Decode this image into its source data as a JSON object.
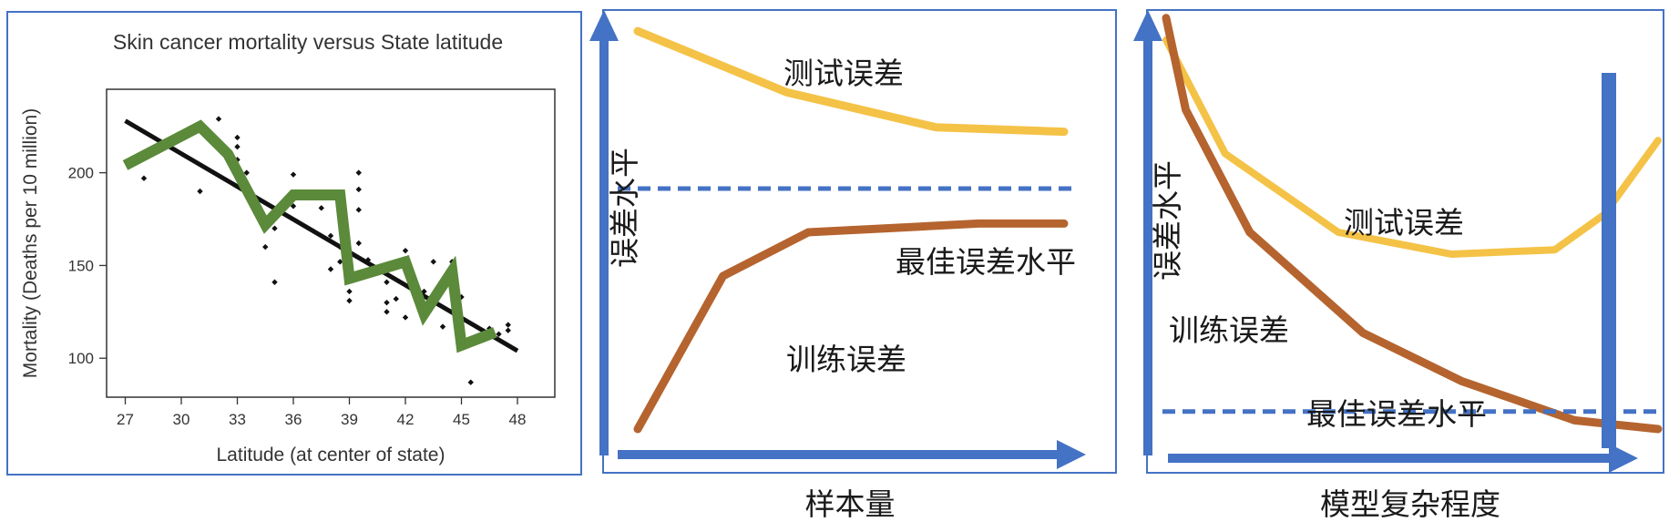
{
  "colors": {
    "frame": "#4472c4",
    "arrow": "#4472c4",
    "train": "#b5642f",
    "test": "#f4c246",
    "green": "#5b8a3a",
    "black": "#111111"
  },
  "chart_data": [
    {
      "type": "scatter",
      "title": "Skin cancer mortality versus State latitude",
      "xlabel": "Latitude (at center of state)",
      "ylabel": "Mortality (Deaths per 10 million)",
      "xlim": [
        26,
        50
      ],
      "ylim": [
        79,
        245
      ],
      "x_ticks": [
        "27",
        "30",
        "33",
        "36",
        "39",
        "42",
        "45",
        "48"
      ],
      "y_ticks": [
        "100",
        "150",
        "200"
      ],
      "points": [
        {
          "x": 28,
          "y": 197
        },
        {
          "x": 31,
          "y": 190
        },
        {
          "x": 32,
          "y": 229
        },
        {
          "x": 33,
          "y": 219
        },
        {
          "x": 33,
          "y": 214
        },
        {
          "x": 33,
          "y": 207
        },
        {
          "x": 33.5,
          "y": 200
        },
        {
          "x": 34,
          "y": 178
        },
        {
          "x": 34.5,
          "y": 160
        },
        {
          "x": 35,
          "y": 170
        },
        {
          "x": 35,
          "y": 141
        },
        {
          "x": 35.5,
          "y": 182
        },
        {
          "x": 36,
          "y": 199
        },
        {
          "x": 36,
          "y": 182
        },
        {
          "x": 37.5,
          "y": 181
        },
        {
          "x": 38,
          "y": 166
        },
        {
          "x": 38,
          "y": 148
        },
        {
          "x": 38.5,
          "y": 160
        },
        {
          "x": 38.5,
          "y": 152
        },
        {
          "x": 39,
          "y": 144
        },
        {
          "x": 39,
          "y": 136
        },
        {
          "x": 39,
          "y": 131
        },
        {
          "x": 39.5,
          "y": 200
        },
        {
          "x": 39.5,
          "y": 191
        },
        {
          "x": 39.5,
          "y": 180
        },
        {
          "x": 39.5,
          "y": 162
        },
        {
          "x": 40,
          "y": 153
        },
        {
          "x": 40.5,
          "y": 146
        },
        {
          "x": 41,
          "y": 141
        },
        {
          "x": 41,
          "y": 130
        },
        {
          "x": 41,
          "y": 125
        },
        {
          "x": 41.5,
          "y": 132
        },
        {
          "x": 42,
          "y": 158
        },
        {
          "x": 42,
          "y": 152
        },
        {
          "x": 42,
          "y": 122
        },
        {
          "x": 42.5,
          "y": 142
        },
        {
          "x": 43,
          "y": 136
        },
        {
          "x": 43,
          "y": 123
        },
        {
          "x": 43.5,
          "y": 152
        },
        {
          "x": 44,
          "y": 117
        },
        {
          "x": 44.5,
          "y": 152
        },
        {
          "x": 45,
          "y": 133
        },
        {
          "x": 45,
          "y": 110
        },
        {
          "x": 45,
          "y": 106
        },
        {
          "x": 45.5,
          "y": 87
        },
        {
          "x": 46,
          "y": 112
        },
        {
          "x": 46.5,
          "y": 116
        },
        {
          "x": 47,
          "y": 113
        },
        {
          "x": 47.5,
          "y": 115
        },
        {
          "x": 47.5,
          "y": 118
        }
      ],
      "regression_line": {
        "x": [
          27,
          48
        ],
        "y": [
          228,
          104
        ]
      },
      "zigzag_overfit": {
        "x": [
          27,
          31,
          32.5,
          34.5,
          36,
          38.5,
          39,
          42,
          43,
          44.5,
          45,
          46.8
        ],
        "y": [
          204,
          225,
          210,
          172,
          188,
          188,
          143,
          152,
          124,
          147,
          107,
          114
        ]
      }
    },
    {
      "type": "line",
      "xlabel": "样本量",
      "ylabel": "误差水平",
      "series": [
        {
          "name": "测试误差",
          "x": [
            0,
            0.35,
            0.7,
            1.0
          ],
          "y": [
            0.96,
            0.82,
            0.74,
            0.73
          ]
        },
        {
          "name": "训练误差",
          "x": [
            0,
            0.2,
            0.4,
            0.6,
            0.8,
            1.0
          ],
          "y": [
            0.05,
            0.4,
            0.5,
            0.51,
            0.52,
            0.52
          ]
        }
      ],
      "reference_line": {
        "label": "最佳误差水平",
        "y": 0.6,
        "style": "dashed"
      },
      "xlim": [
        0,
        1
      ],
      "ylim": [
        0,
        1
      ]
    },
    {
      "type": "line",
      "xlabel": "模型复杂程度",
      "ylabel": "误差水平",
      "series": [
        {
          "name": "测试误差",
          "x": [
            0,
            0.12,
            0.35,
            0.58,
            0.79,
            0.89,
            1.0
          ],
          "y": [
            0.94,
            0.68,
            0.5,
            0.45,
            0.46,
            0.54,
            0.71
          ]
        },
        {
          "name": "训练误差",
          "x": [
            0,
            0.04,
            0.17,
            0.4,
            0.6,
            0.83,
            1.0
          ],
          "y": [
            0.99,
            0.78,
            0.5,
            0.27,
            0.16,
            0.07,
            0.05
          ]
        }
      ],
      "reference_line": {
        "label": "最佳误差水平",
        "y": 0.09,
        "style": "dashed"
      },
      "highlight_x": 0.9,
      "xlim": [
        0,
        1
      ],
      "ylim": [
        0,
        1
      ]
    }
  ]
}
